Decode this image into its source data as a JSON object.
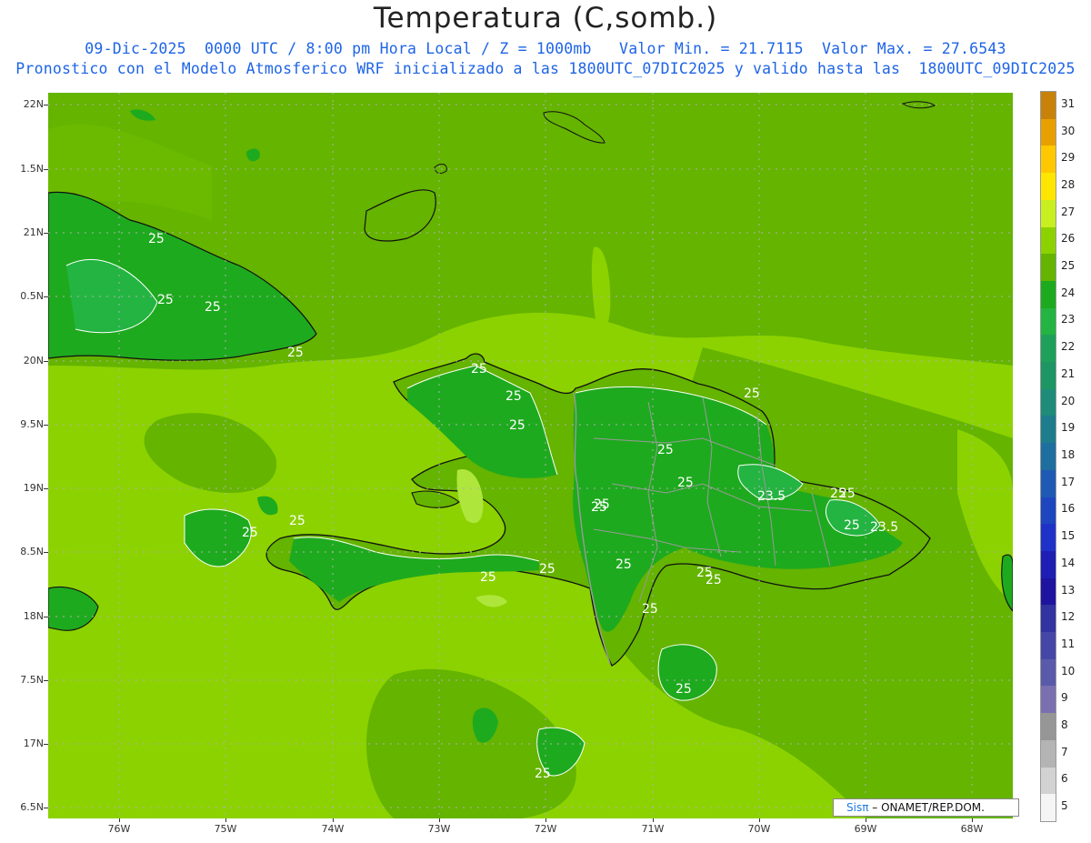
{
  "title": "Temperatura (C,somb.)",
  "subtitle_line1": "09-Dic-2025  0000 UTC / 8:00 pm Hora Local / Z = 1000mb   Valor Min. = 21.7115  Valor Max. = 27.6543",
  "subtitle_line2": "Pronostico con el Modelo Atmosferico WRF inicializado a las 1800UTC_07DIC2025 y valido hasta las  1800UTC_09DIC2025",
  "lat_labels": [
    "22N",
    "1.5N",
    "21N",
    "0.5N",
    "20N",
    "9.5N",
    "19N",
    "8.5N",
    "18N",
    "7.5N",
    "17N",
    "6.5N"
  ],
  "lon_labels": [
    "76W",
    "75W",
    "74W",
    "73W",
    "72W",
    "71W",
    "70W",
    "69W",
    "68W"
  ],
  "colorbar": {
    "labels": [
      "31",
      "30",
      "29",
      "28",
      "27",
      "26",
      "25",
      "24",
      "23",
      "22",
      "21",
      "20",
      "19",
      "18",
      "17",
      "16",
      "15",
      "14",
      "13",
      "12",
      "11",
      "10",
      "9",
      "8",
      "7",
      "6",
      "5"
    ],
    "colors": [
      "#c8820a",
      "#e8a000",
      "#ffc800",
      "#ffe600",
      "#c8f020",
      "#8cd200",
      "#64b400",
      "#1eaa1e",
      "#23b441",
      "#1ea05a",
      "#1e9664",
      "#1e8c78",
      "#1e7d8c",
      "#1e6ea0",
      "#1e5ab4",
      "#1e46be",
      "#1e32c8",
      "#1e1eb4",
      "#1e14a0",
      "#3232a0",
      "#4646a6",
      "#5a5aaa",
      "#7a70b0",
      "#969696",
      "#b4b4b4",
      "#d2d2d2",
      "#f5f5f5"
    ]
  },
  "contour_labels": [
    "25",
    "25",
    "25",
    "25",
    "25",
    "25",
    "25",
    "25",
    "25",
    "25",
    "25",
    "25",
    "23.5",
    "25",
    "25",
    "23.5",
    "25",
    "25",
    "25",
    "25",
    "25",
    "25",
    "25",
    "25",
    "25",
    "25",
    "25"
  ],
  "credit": {
    "brand": "Sisπ",
    "rest": "– ONAMET/REP.DOM."
  },
  "colors": {
    "sea_light": "#8cd200",
    "land_dark": "#1eaa1e",
    "mid_green": "#64b400",
    "bright": "#aee63c",
    "subtitle": "#1e64e6"
  }
}
